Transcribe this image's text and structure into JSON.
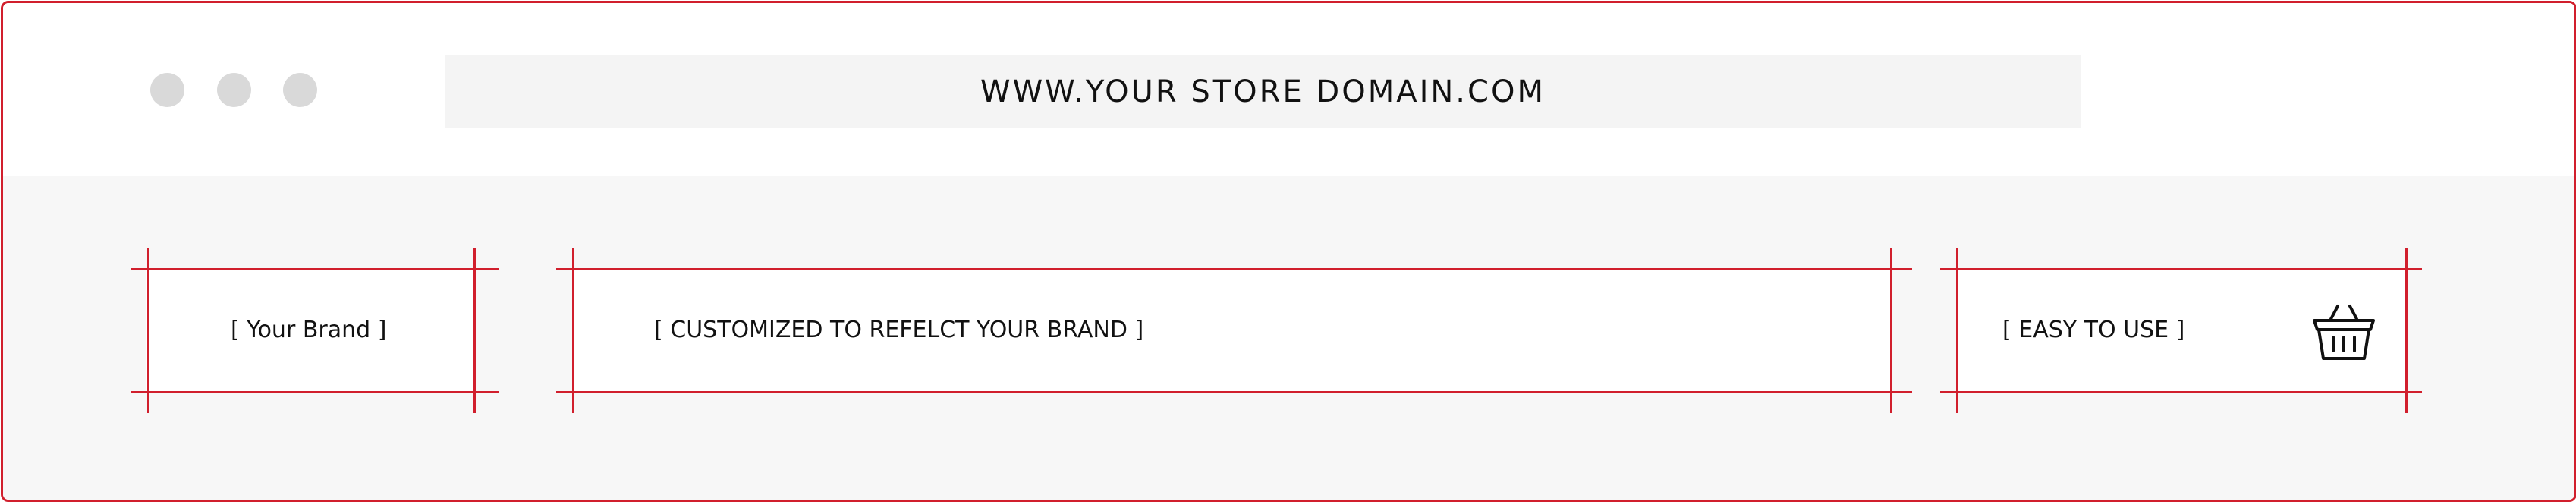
{
  "window": {
    "controls": [
      "window-dot",
      "window-dot",
      "window-dot"
    ],
    "url": "WWW.YOUR STORE DOMAIN.COM"
  },
  "wireframe": {
    "brand_label": "[ Your Brand ]",
    "nav_label": "[ CUSTOMIZED TO REFELCT YOUR BRAND ]",
    "cart_label": "[ EASY TO USE ]",
    "cart_icon": "basket-icon"
  },
  "colors": {
    "accent": "#d11f2d",
    "content_bg": "#f7f7f7",
    "url_bar_bg": "#f4f4f4",
    "dot": "#d9d9d9"
  }
}
